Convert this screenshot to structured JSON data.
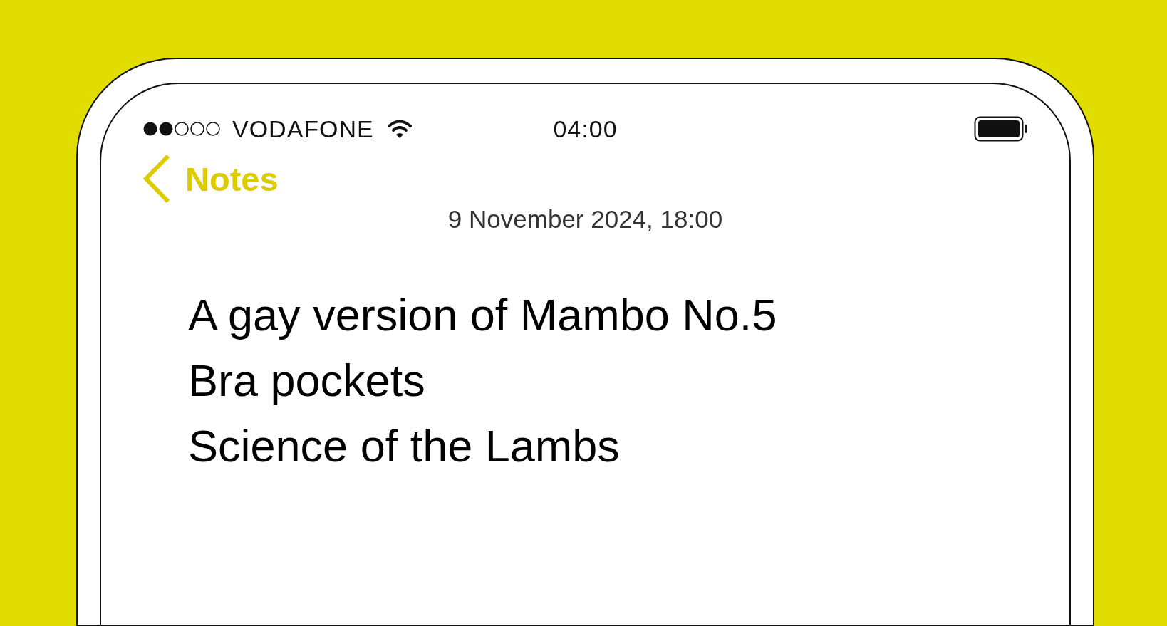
{
  "status_bar": {
    "carrier": "VODAFONE",
    "time": "04:00"
  },
  "nav": {
    "back_label": "Notes"
  },
  "note": {
    "date": "9 November 2024, 18:00",
    "lines": [
      "A gay version of Mambo No.5",
      "Bra pockets",
      "Science of the Lambs"
    ]
  }
}
